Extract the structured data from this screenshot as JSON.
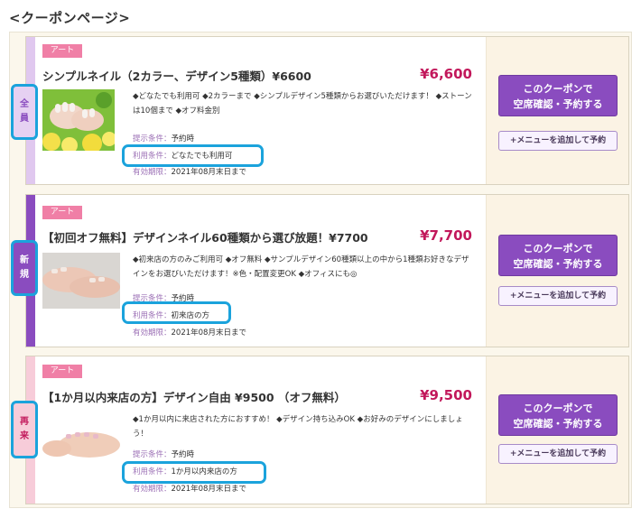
{
  "page_title": "<クーポンページ>",
  "colors": {
    "stripe_1": "#e0c8ef",
    "stripe_2": "#8a4cbf",
    "stripe_3": "#f7ccd9",
    "price": "#c2185b",
    "tag": "#f07fa6",
    "button": "#8a4cbf",
    "highlight": "#1ba3dc"
  },
  "coupons": [
    {
      "label_line1": "全",
      "label_line2": "員",
      "tag": "アート",
      "title": "シンプルネイル（2カラー、デザイン5種類）¥6600",
      "price": "¥6,600",
      "description": "◆どなたでも利用可 ◆2カラーまで ◆シンプルデザイン5種類からお選びいただけます！ ◆ストーンは10個まで ◆オフ料金別",
      "cond_present_key": "提示条件：",
      "cond_present_val": "予約時",
      "cond_use_key": "利用条件：",
      "cond_use_val": "どなたでも利用可",
      "cond_expiry_key": "有効期限：",
      "cond_expiry_val": "2021年08月末日まで",
      "button_main_1": "このクーポンで",
      "button_main_2": "空席確認・予約する",
      "button_sub": "+メニューを追加して予約",
      "image_icon": "nail-flowers-photo"
    },
    {
      "label_line1": "新",
      "label_line2": "規",
      "tag": "アート",
      "title": "【初回オフ無料】デザインネイル60種類から選び放題！¥7700",
      "price": "¥7,700",
      "description": "◆初来店の方のみご利用可 ◆オフ無料 ◆サンプルデザイン60種類以上の中から1種類お好きなデザインをお選びいただけます！※色・配置変更OK ◆オフィスにも◎",
      "cond_present_key": "提示条件：",
      "cond_present_val": "予約時",
      "cond_use_key": "利用条件：",
      "cond_use_val": "初来店の方",
      "cond_expiry_key": "有効期限：",
      "cond_expiry_val": "2021年08月末日まで",
      "button_main_1": "このクーポンで",
      "button_main_2": "空席確認・予約する",
      "button_sub": "+メニューを追加して予約",
      "image_icon": "nail-hands-photo"
    },
    {
      "label_line1": "再",
      "label_line2": "来",
      "tag": "アート",
      "title": "【1か月以内来店の方】デザイン自由 ¥9500 （オフ無料）",
      "price": "¥9,500",
      "description": "◆1か月以内に来店された方におすすめ！ ◆デザイン持ち込みOK ◆お好みのデザインにしましょう！",
      "cond_present_key": "提示条件：",
      "cond_present_val": "予約時",
      "cond_use_key": "利用条件：",
      "cond_use_val": "1か月以内来店の方",
      "cond_expiry_key": "有効期限：",
      "cond_expiry_val": "2021年08月末日まで",
      "button_main_1": "このクーポンで",
      "button_main_2": "空席確認・予約する",
      "button_sub": "+メニューを追加して予約",
      "image_icon": "nail-hand-pink-photo"
    }
  ]
}
